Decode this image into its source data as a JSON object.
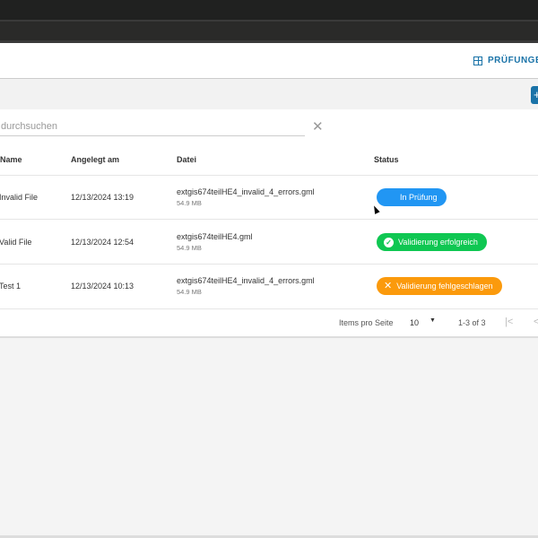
{
  "header": {
    "pruefungen_label": "PRÜFUNGEN"
  },
  "toolbar": {
    "add_label": "+"
  },
  "search": {
    "placeholder": "durchsuchen"
  },
  "table": {
    "columns": [
      "Name",
      "Angelegt am",
      "Datei",
      "Status"
    ],
    "rows": [
      {
        "name": "Invalid File",
        "created": "12/13/2024 13:19",
        "file": "extgis674teilHE4_invalid_4_errors.gml",
        "size": "54.9 MB",
        "status": "In Prüfung"
      },
      {
        "name": "Valid File",
        "created": "12/13/2024 12:54",
        "file": "extgis674teilHE4.gml",
        "size": "54.9 MB",
        "status": "Validierung erfolgreich"
      },
      {
        "name": "Test 1",
        "created": "12/13/2024 10:13",
        "file": "extgis674teilHE4_invalid_4_errors.gml",
        "size": "54.9 MB",
        "status": "Validierung fehlgeschlagen"
      }
    ]
  },
  "paginator": {
    "items_label": "Items pro Seite",
    "page_size": "10",
    "range": "1-3 of 3"
  },
  "colors": {
    "accent": "#1a73a8",
    "in_progress": "#2196f3",
    "success": "#0fc752",
    "failed": "#fb9a0c"
  }
}
